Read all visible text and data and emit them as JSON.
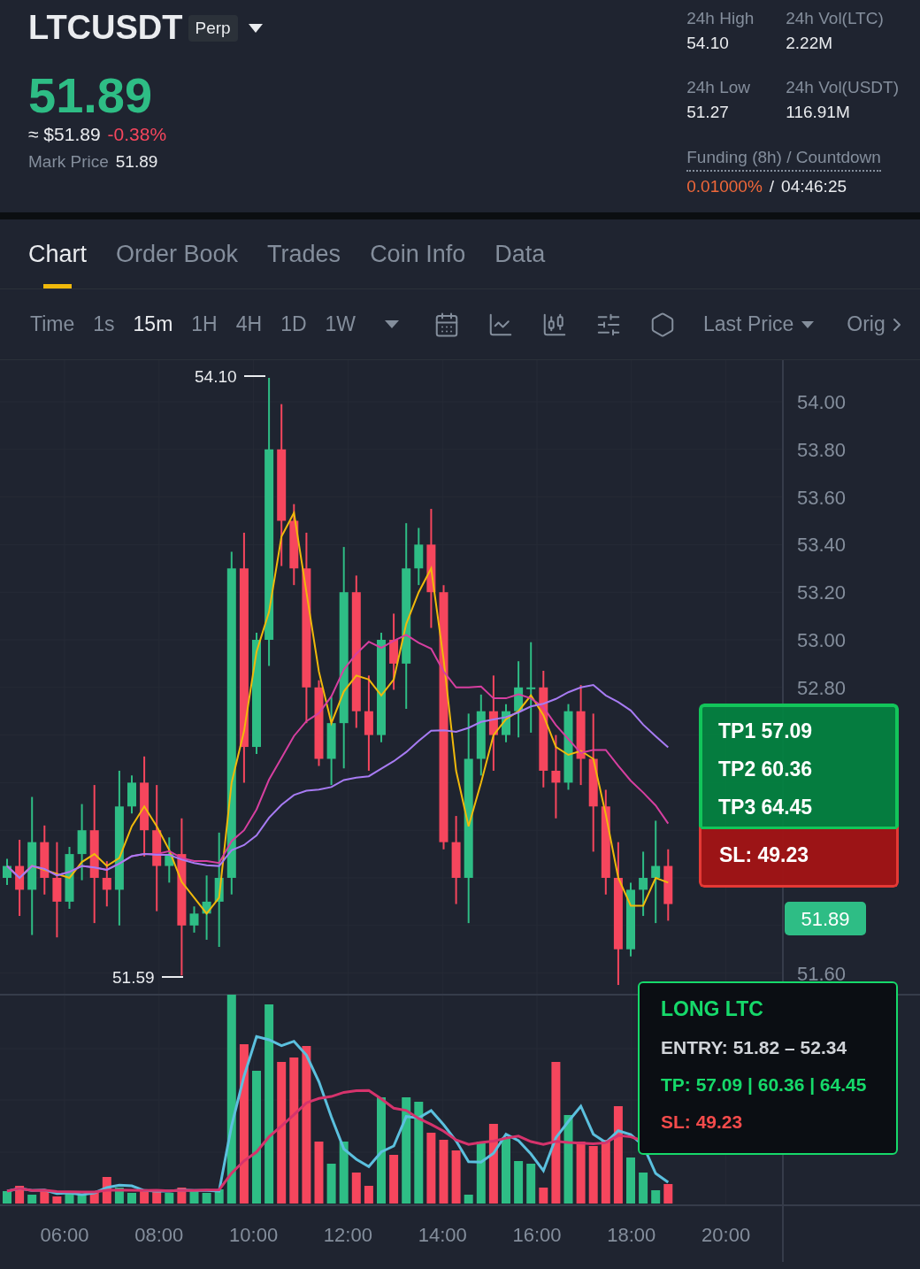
{
  "header": {
    "symbol": "LTCUSDT",
    "contract_badge": "Perp",
    "last_price": "51.89",
    "usd_price": "≈ $51.89",
    "change": "-0.38%",
    "mark_price_label": "Mark Price",
    "mark_price": "51.89",
    "stats": [
      {
        "label": "24h High",
        "value": "54.10"
      },
      {
        "label": "24h Vol(LTC)",
        "value": "2.22M"
      },
      {
        "label": "24h Low",
        "value": "51.27"
      },
      {
        "label": "24h Vol(USDT)",
        "value": "116.91M"
      }
    ],
    "funding": {
      "label": "Funding (8h) / Countdown",
      "rate": "0.01000%",
      "separator": "/",
      "countdown": "04:46:25"
    }
  },
  "tabs": [
    {
      "label": "Chart",
      "selected": true
    },
    {
      "label": "Order Book",
      "selected": false
    },
    {
      "label": "Trades",
      "selected": false
    },
    {
      "label": "Coin Info",
      "selected": false
    },
    {
      "label": "Data",
      "selected": false
    }
  ],
  "toolbar": {
    "interval_label": "Time",
    "intervals": [
      {
        "label": "1s",
        "selected": false
      },
      {
        "label": "15m",
        "selected": true
      },
      {
        "label": "1H",
        "selected": false
      },
      {
        "label": "4H",
        "selected": false
      },
      {
        "label": "1D",
        "selected": false
      },
      {
        "label": "1W",
        "selected": false
      }
    ],
    "price_type": "Last Price",
    "more": "Orig"
  },
  "chart": {
    "price_ticks_upper": [
      "54.00",
      "53.80",
      "53.60",
      "53.40",
      "53.20",
      "53.00",
      "52.80"
    ],
    "price_ticks_lower": [
      "51.60"
    ],
    "high_marker": "54.10",
    "low_marker": "51.59",
    "current_price": "51.89",
    "time_ticks": [
      "06:00",
      "08:00",
      "10:00",
      "12:00",
      "14:00",
      "16:00",
      "18:00",
      "20:00"
    ]
  },
  "targets": {
    "take_profits": [
      "TP1 57.09",
      "TP2 60.36",
      "TP3 64.45"
    ],
    "stop_loss": "SL: 49.23"
  },
  "signal": {
    "title": "LONG LTC",
    "lines": [
      {
        "kind": "entry",
        "text": "ENTRY: 51.82 – 52.34"
      },
      {
        "kind": "tp",
        "text": "TP: 57.09 | 60.36 | 64.45"
      },
      {
        "kind": "sl",
        "text": "SL: 49.23"
      }
    ]
  }
}
